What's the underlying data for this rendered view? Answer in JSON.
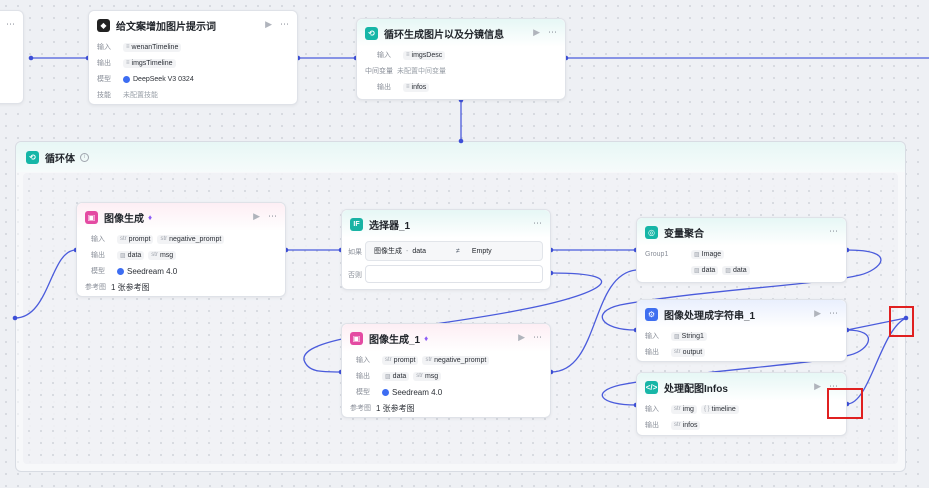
{
  "canvas": {
    "accent": "#4a5bdc"
  },
  "node_prompt": {
    "title": "给文案增加图片提示词",
    "input_label": "输入",
    "input_var": "wenanTimeline",
    "output_label": "输出",
    "output_var": "imgsTimeline",
    "model_label": "模型",
    "model": "DeepSeek V3 0324",
    "skill_label": "技能",
    "skill_value": "未配置技能"
  },
  "node_loop_gen": {
    "title": "循环生成图片以及分镜信息",
    "input_label": "输入",
    "input_var": "imgsDesc",
    "mid_label": "中间变量",
    "mid_value": "未配置中间变量",
    "output_label": "输出",
    "output_var": "infos"
  },
  "group": {
    "title": "循环体"
  },
  "node_image_gen": {
    "title": "图像生成",
    "input_label": "输入",
    "inputs": [
      "prompt",
      "negative_prompt"
    ],
    "output_label": "输出",
    "outputs": [
      "data",
      "msg"
    ],
    "model_label": "模型",
    "model": "Seedream 4.0",
    "ref_label": "参考图",
    "ref_value": "1 张参考图"
  },
  "node_selector": {
    "title": "选择器_1",
    "if_label": "如果",
    "cond_left": "图像生成",
    "cond_var": "data",
    "cond_op": "≠",
    "cond_right": "Empty",
    "else_label": "否则"
  },
  "node_image_gen_1": {
    "title": "图像生成_1",
    "input_label": "输入",
    "inputs": [
      "prompt",
      "negative_prompt"
    ],
    "output_label": "输出",
    "outputs": [
      "data",
      "msg"
    ],
    "model_label": "模型",
    "model": "Seedream 4.0",
    "ref_label": "参考图",
    "ref_value": "1 张参考图"
  },
  "node_var_agg": {
    "title": "变量聚合",
    "group_label": "Group1",
    "items": [
      "Image",
      "data",
      "data"
    ]
  },
  "node_img_str": {
    "title": "图像处理成字符串_1",
    "input_label": "输入",
    "input_var": "String1",
    "output_label": "输出",
    "output_var": "output"
  },
  "node_proc": {
    "title": "处理配图Infos",
    "input_label": "输入",
    "inputs": [
      "img",
      "timeline"
    ],
    "output_label": "输出",
    "output_var": "infos"
  },
  "icons": {
    "more": "⋯",
    "play": "▶",
    "str": "str",
    "img": "▨",
    "obj": "{ }"
  }
}
